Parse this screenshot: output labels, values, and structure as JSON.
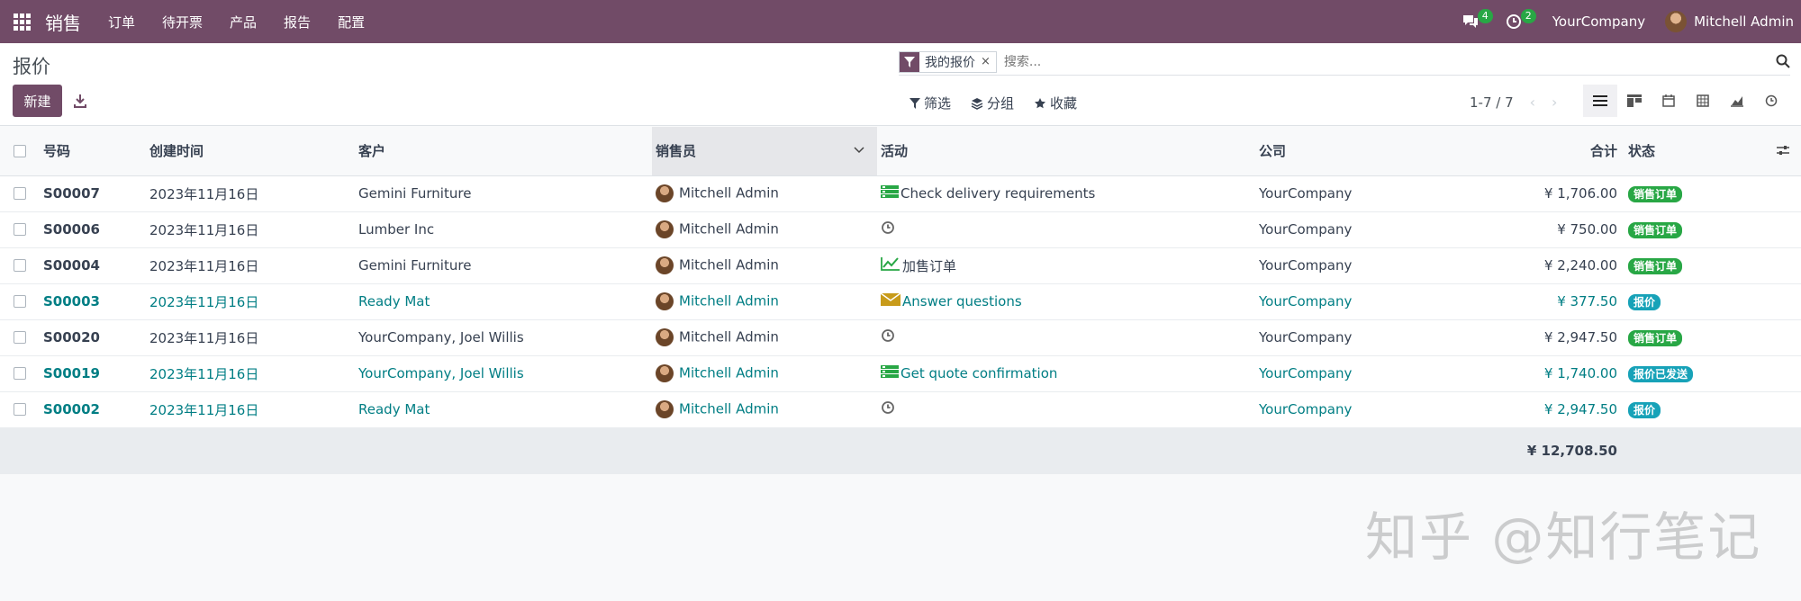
{
  "navbar": {
    "app_name": "销售",
    "menus": [
      "订单",
      "待开票",
      "产品",
      "报告",
      "配置"
    ],
    "messages_count": "4",
    "activities_count": "2",
    "company": "YourCompany",
    "user": "Mitchell Admin",
    "bg_color": "#714b67"
  },
  "control": {
    "breadcrumb": "报价",
    "new_button": "新建",
    "search": {
      "facet": "我的报价",
      "facet_remove": "×",
      "placeholder": "搜索..."
    },
    "filters": {
      "filter_label": "筛选",
      "group_label": "分组",
      "favorite_label": "收藏"
    },
    "pager": "1-7 / 7",
    "views": [
      "list-icon",
      "kanban-icon",
      "calendar-icon",
      "pivot-icon",
      "graph-icon",
      "activity-icon"
    ]
  },
  "table": {
    "headers": {
      "number": "号码",
      "created": "创建时间",
      "customer": "客户",
      "salesperson": "销售员",
      "activity": "活动",
      "company": "公司",
      "total": "合计",
      "status": "状态"
    },
    "rows": [
      {
        "number": "S00007",
        "created": "2023年11月16日",
        "customer": "Gemini Furniture",
        "salesperson": "Mitchell Admin",
        "activity_icon": "task-icon",
        "activity": "Check delivery requirements",
        "company": "YourCompany",
        "total": "¥ 1,706.00",
        "status": "销售订单",
        "highlight": false
      },
      {
        "number": "S00006",
        "created": "2023年11月16日",
        "customer": "Lumber Inc",
        "salesperson": "Mitchell Admin",
        "activity_icon": "clock-icon",
        "activity": "",
        "company": "YourCompany",
        "total": "¥ 750.00",
        "status": "销售订单",
        "highlight": false
      },
      {
        "number": "S00004",
        "created": "2023年11月16日",
        "customer": "Gemini Furniture",
        "salesperson": "Mitchell Admin",
        "activity_icon": "chart-line-icon",
        "activity": "加售订单",
        "company": "YourCompany",
        "total": "¥ 2,240.00",
        "status": "销售订单",
        "highlight": false
      },
      {
        "number": "S00003",
        "created": "2023年11月16日",
        "customer": "Ready Mat",
        "salesperson": "Mitchell Admin",
        "activity_icon": "envelope-icon",
        "activity": "Answer questions",
        "company": "YourCompany",
        "total": "¥ 377.50",
        "status": "报价",
        "highlight": true
      },
      {
        "number": "S00020",
        "created": "2023年11月16日",
        "customer": "YourCompany, Joel Willis",
        "salesperson": "Mitchell Admin",
        "activity_icon": "clock-icon",
        "activity": "",
        "company": "YourCompany",
        "total": "¥ 2,947.50",
        "status": "销售订单",
        "highlight": false
      },
      {
        "number": "S00019",
        "created": "2023年11月16日",
        "customer": "YourCompany, Joel Willis",
        "salesperson": "Mitchell Admin",
        "activity_icon": "task-icon",
        "activity": "Get quote confirmation",
        "company": "YourCompany",
        "total": "¥ 1,740.00",
        "status": "报价已发送",
        "highlight": true
      },
      {
        "number": "S00002",
        "created": "2023年11月16日",
        "customer": "Ready Mat",
        "salesperson": "Mitchell Admin",
        "activity_icon": "clock-icon",
        "activity": "",
        "company": "YourCompany",
        "total": "¥ 2,947.50",
        "status": "报价",
        "highlight": true
      }
    ],
    "grand_total": "¥ 12,708.50"
  },
  "watermark": "知乎 @知行笔记",
  "colors": {
    "accent": "#714b67",
    "link_teal": "#017e84",
    "status_green": "#28a745",
    "status_cyan": "#17a2b8"
  }
}
